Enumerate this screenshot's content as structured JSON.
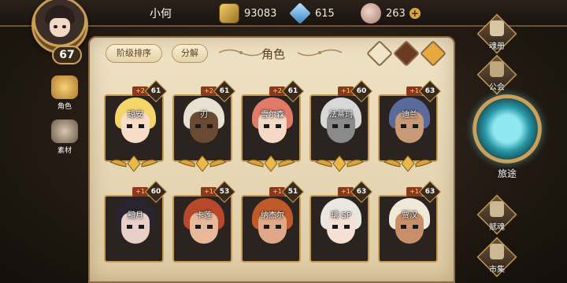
{
  "player": {
    "name": "小何",
    "level": "67"
  },
  "currencies": [
    {
      "icon": "gold-ore-icon",
      "value": "93083",
      "color": "#d6a640"
    },
    {
      "icon": "blue-crystal-icon",
      "value": "615",
      "color": "#5aa0e0"
    },
    {
      "icon": "pink-stone-icon",
      "value": "263",
      "color": "#d8b0a0"
    }
  ],
  "plus_label": "+",
  "side_tabs": [
    {
      "label": "角色",
      "active": true
    },
    {
      "label": "素材",
      "active": false
    }
  ],
  "panel": {
    "title": "角色",
    "sort_label": "阶级排序",
    "split_label": "分解",
    "filters": [
      "heart-icon",
      "sword-icon",
      "star-icon"
    ]
  },
  "heroes": [
    {
      "name": "琼安",
      "stars": "+2",
      "level": "61",
      "hair": "#f4d56a",
      "face": "#f7dcc8"
    },
    {
      "name": "刃",
      "stars": "+2",
      "level": "61",
      "hair": "#e8e0d0",
      "face": "#6a4a32"
    },
    {
      "name": "雪尔森",
      "stars": "+2",
      "level": "61",
      "hair": "#e07a6a",
      "face": "#f6d8c6"
    },
    {
      "name": "法蒂玛",
      "stars": "+1",
      "level": "60",
      "hair": "#d8d8d8",
      "face": "#8a8a8a"
    },
    {
      "name": "迪兰",
      "stars": "+1",
      "level": "63",
      "hair": "#5a6a9a",
      "face": "#c89a78"
    },
    {
      "name": "黯月",
      "stars": "+1",
      "level": "60",
      "hair": "#2a2430",
      "face": "#e8d0c8"
    },
    {
      "name": "卡莲",
      "stars": "+1",
      "level": "53",
      "hair": "#b8482a",
      "face": "#e8b89a"
    },
    {
      "name": "纳杰尔",
      "stars": "+1",
      "level": "51",
      "hair": "#c05a2a",
      "face": "#e0a888"
    },
    {
      "name": "璃 SP",
      "stars": "+1",
      "level": "63",
      "hair": "#e8e8e0",
      "face": "#f6e0d6"
    },
    {
      "name": "贾汉",
      "stars": "+1",
      "level": "63",
      "hair": "#f0e8d8",
      "face": "#c8906a"
    }
  ],
  "nav": {
    "soulbook": "魂册",
    "guild": "公会",
    "journey": "旅途",
    "gift": "赋魂",
    "market": "市集"
  },
  "colors": {
    "accent_gold": "#c89a52",
    "parchment": "#e8d8b6",
    "journey_teal": "#2a9aa8"
  }
}
